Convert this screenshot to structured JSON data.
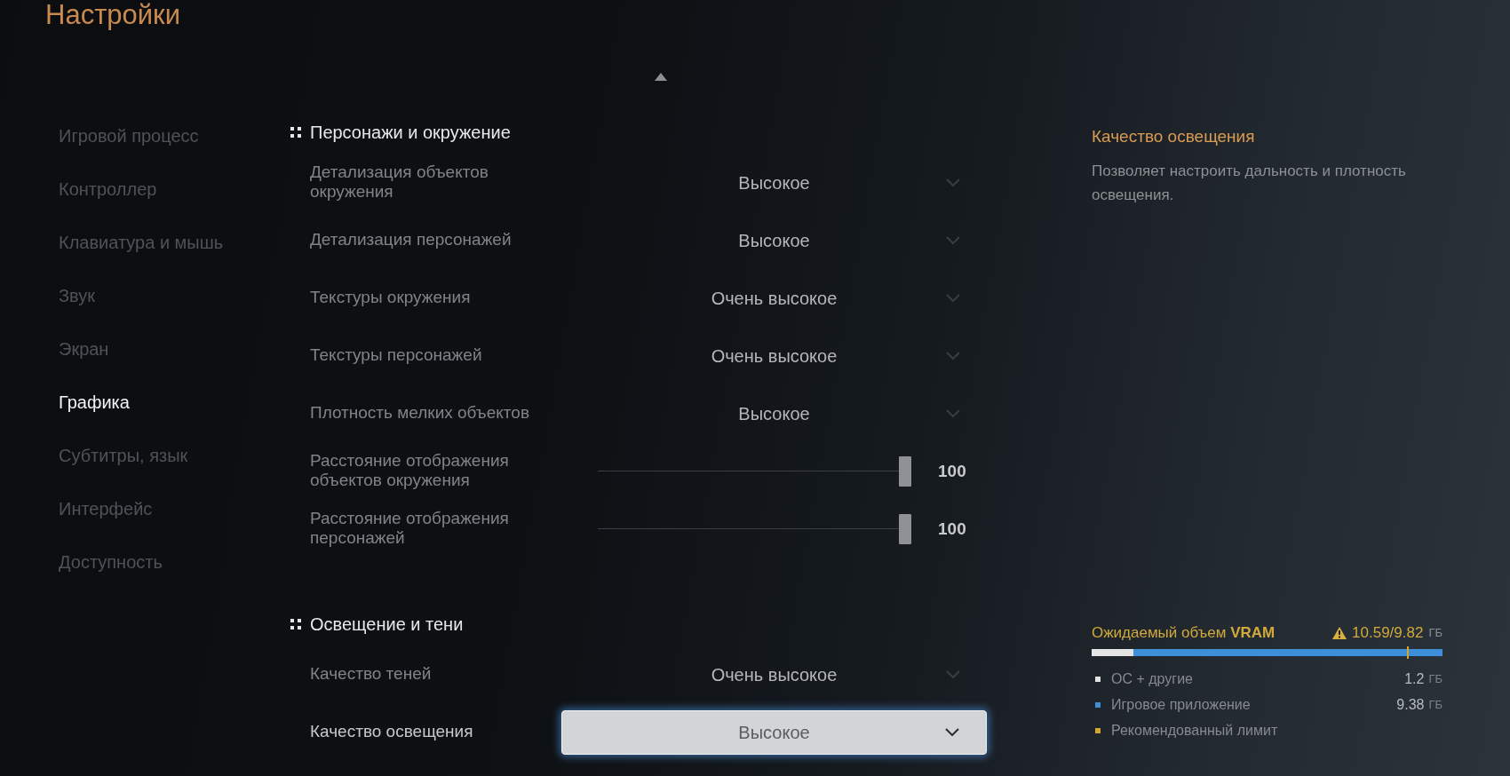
{
  "title": "Настройки",
  "sidebar": {
    "items": [
      {
        "label": "Игровой процесс",
        "selected": false
      },
      {
        "label": "Контроллер",
        "selected": false
      },
      {
        "label": "Клавиатура и мышь",
        "selected": false
      },
      {
        "label": "Звук",
        "selected": false
      },
      {
        "label": "Экран",
        "selected": false
      },
      {
        "label": "Графика",
        "selected": true
      },
      {
        "label": "Субтитры, язык",
        "selected": false
      },
      {
        "label": "Интерфейс",
        "selected": false
      },
      {
        "label": "Доступность",
        "selected": false
      }
    ]
  },
  "content": {
    "sections": [
      {
        "title": "Персонажи и окружение",
        "rows": [
          {
            "kind": "dropdown",
            "label": "Детализация объектов окружения",
            "value": "Высокое",
            "focused": false
          },
          {
            "kind": "dropdown",
            "label": "Детализация персонажей",
            "value": "Высокое",
            "focused": false
          },
          {
            "kind": "dropdown",
            "label": "Текстуры окружения",
            "value": "Очень высокое",
            "focused": false
          },
          {
            "kind": "dropdown",
            "label": "Текстуры персонажей",
            "value": "Очень высокое",
            "focused": false
          },
          {
            "kind": "dropdown",
            "label": "Плотность мелких объектов",
            "value": "Высокое",
            "focused": false
          },
          {
            "kind": "slider",
            "label": "Расстояние отображения объектов окружения",
            "level": 1,
            "value": "100"
          },
          {
            "kind": "slider",
            "label": "Расстояние отображения персонажей",
            "level": 1,
            "value": "100"
          }
        ]
      },
      {
        "title": "Освещение и тени",
        "rows": [
          {
            "kind": "dropdown",
            "label": "Качество теней",
            "value": "Очень высокое",
            "focused": false
          },
          {
            "kind": "dropdown",
            "label": "Качество освещения",
            "value": "Высокое",
            "focused": true
          }
        ]
      }
    ]
  },
  "description": {
    "title": "Качество освещения",
    "text": "Позволяет настроить дальность и плотность освещения."
  },
  "vram": {
    "title": "Ожидаемый объем **VRAM**",
    "warning": true,
    "total": "10.59/9.82",
    "unit": "ГБ",
    "items": [
      {
        "kind": "segment",
        "label": "ОС + другие",
        "value": "1.2",
        "unit": "ГБ",
        "color": "#e4e4e4",
        "level": 0.12
      },
      {
        "kind": "segment",
        "label": "Игровое приложение",
        "value": "9.38",
        "unit": "ГБ",
        "color": "#3d8fd8",
        "level": 0.88
      },
      {
        "kind": "marker",
        "label": "Рекомендованный лимит",
        "color": "#d4a72c",
        "level": 0.9
      }
    ]
  }
}
